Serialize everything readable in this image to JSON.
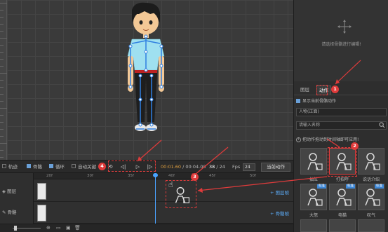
{
  "right_panel": {
    "bone_hint": "请选择骨骼进行编辑!",
    "tabs": [
      "图层",
      "动作"
    ],
    "show_current_bones": "显示当前骨骼动作",
    "character_view": "人物(正面)",
    "search_placeholder": "请输入名称",
    "info_text": "把动作拖动到时间轴即可应用!",
    "actions": [
      {
        "label": "抽泣",
        "badge": ""
      },
      {
        "label": "打招呼",
        "badge": ""
      },
      {
        "label": "说话介绍",
        "badge": ""
      },
      {
        "label": "大怒",
        "badge": "标准"
      },
      {
        "label": "电猫",
        "badge": "标准"
      },
      {
        "label": "叹气",
        "badge": "标准"
      }
    ]
  },
  "toolbar": {
    "track_label": "轨迹",
    "bones_label": "骨骼",
    "loop_label": "循环",
    "auto_key_label": "自动关键",
    "time_current": "00:01.60",
    "time_separator": " / ",
    "time_total": "00:04.00",
    "frame_current": "38",
    "frame_separator": " / ",
    "frame_total": "24",
    "fps_label": "Fps",
    "fps_value": "24",
    "export_label": "当前动作"
  },
  "timeline": {
    "ruler_labels": [
      "20f",
      "30f",
      "35f",
      "40f",
      "45f",
      "50f"
    ],
    "layer_label": "图层",
    "bone_label": "骨骼",
    "add_layer": "+ 图层帧",
    "add_bone": "+ 骨骼帧"
  },
  "annotations": [
    "1",
    "2",
    "3",
    "4"
  ],
  "colors": {
    "accent": "#4aa3ff",
    "annotation": "#e03b3b",
    "badge": "#3d87d6"
  }
}
